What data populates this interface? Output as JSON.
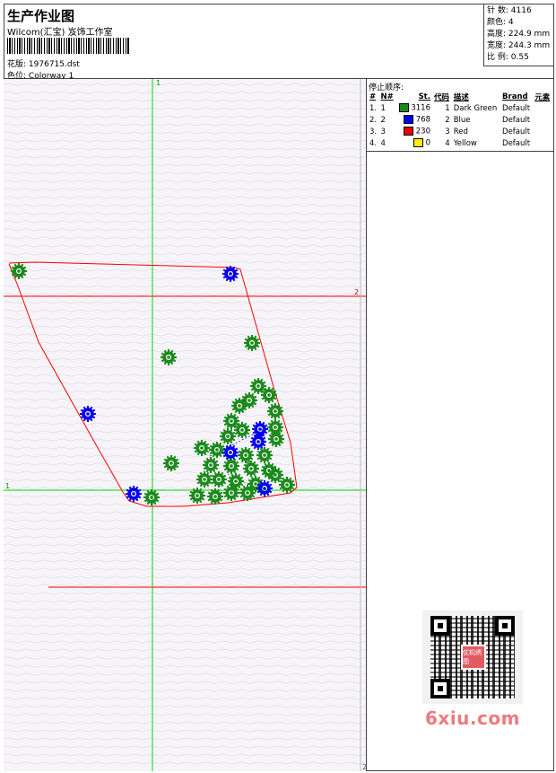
{
  "header": {
    "title": "生产作业图",
    "studio": "Wilcom(汇宝) 岌饰工作室",
    "design_label": "花版:",
    "design_value": "1976715.dst",
    "colorway_label": "色位:",
    "colorway_value": "Colorway 1"
  },
  "stats": [
    {
      "label": "针 数:",
      "value": "4116"
    },
    {
      "label": "颜色:",
      "value": "4"
    },
    {
      "label": "高度:",
      "value": "224.9 mm"
    },
    {
      "label": "宽度:",
      "value": "244.3 mm"
    },
    {
      "label": "比 例:",
      "value": "0.55"
    }
  ],
  "canvas": {
    "marker_top": "1",
    "marker_right": "2",
    "marker_left": "1",
    "marker_bottom": "2",
    "colors": {
      "background": "#f6f4f8",
      "guide": "#00dd00",
      "outline": "#ff0000",
      "green": "#1a8a1a",
      "blue": "#0000ee"
    }
  },
  "stop_sequence": {
    "title": "停止顺序:",
    "headers": [
      "#",
      "N#",
      "St.",
      "代码",
      "描述",
      "Brand",
      "元素"
    ],
    "rows": [
      {
        "idx": "1.",
        "n": "1",
        "color": "#1a8a1a",
        "stitches": "3116",
        "code": "1",
        "desc": "Dark Green",
        "brand": "Default",
        "element": ""
      },
      {
        "idx": "2.",
        "n": "2",
        "color": "#0000ee",
        "stitches": "768",
        "code": "2",
        "desc": "Blue",
        "brand": "Default",
        "element": ""
      },
      {
        "idx": "3.",
        "n": "3",
        "color": "#ee0000",
        "stitches": "230",
        "code": "3",
        "desc": "Red",
        "brand": "Default",
        "element": ""
      },
      {
        "idx": "4.",
        "n": "4",
        "color": "#ffee00",
        "stitches": "0",
        "code": "4",
        "desc": "Yellow",
        "brand": "Default",
        "element": ""
      }
    ]
  },
  "watermark": {
    "text": "6xiu.com",
    "qr_logo": "仗机绣图"
  }
}
